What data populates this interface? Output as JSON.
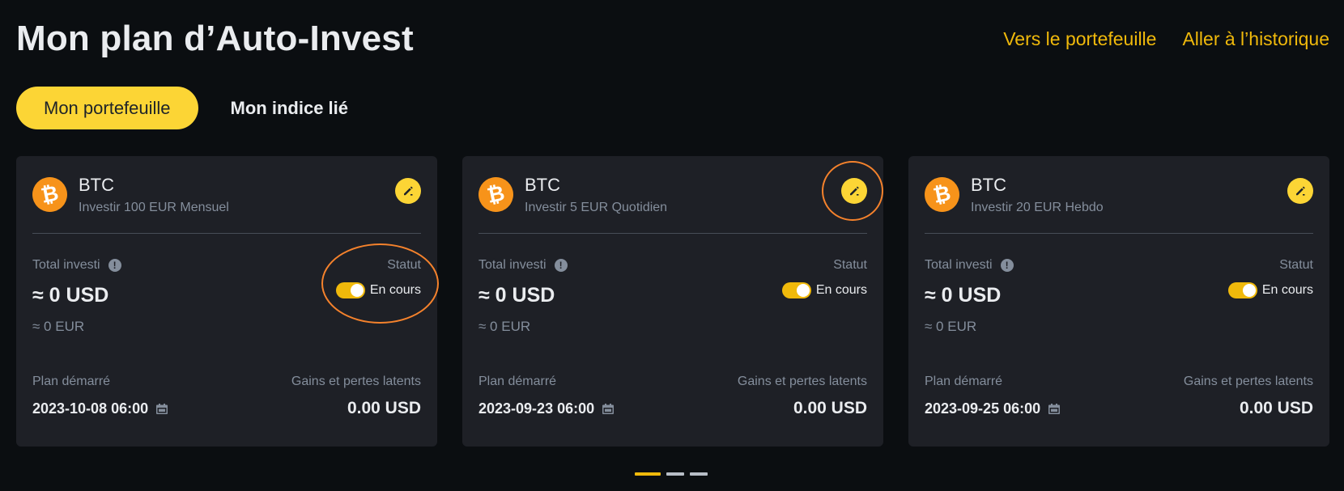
{
  "header": {
    "title": "Mon plan d’Auto-Invest",
    "links": [
      "Vers le portefeuille",
      "Aller à l’historique"
    ]
  },
  "tabs": [
    {
      "label": "Mon portefeuille",
      "active": true
    },
    {
      "label": "Mon indice lié",
      "active": false
    }
  ],
  "labels": {
    "total_invested": "Total investi",
    "status": "Statut",
    "plan_started": "Plan démarré",
    "unrealized_pnl": "Gains et pertes latents"
  },
  "cards": [
    {
      "coin": "BTC",
      "description": "Investir 100 EUR Mensuel",
      "total_usd": "≈ 0 USD",
      "total_eur": "≈ 0 EUR",
      "status": "En cours",
      "status_on": true,
      "start_date": "2023-10-08 06:00",
      "pnl": "0.00 USD"
    },
    {
      "coin": "BTC",
      "description": "Investir 5 EUR Quotidien",
      "total_usd": "≈ 0 USD",
      "total_eur": "≈ 0 EUR",
      "status": "En cours",
      "status_on": true,
      "start_date": "2023-09-23 06:00",
      "pnl": "0.00 USD"
    },
    {
      "coin": "BTC",
      "description": "Investir 20 EUR Hebdo",
      "total_usd": "≈ 0 USD",
      "total_eur": "≈ 0 EUR",
      "status": "En cours",
      "status_on": true,
      "start_date": "2023-09-25 06:00",
      "pnl": "0.00 USD"
    }
  ],
  "pager": {
    "pages": 3,
    "active": 0
  },
  "colors": {
    "accent": "#f0b90b",
    "annotation": "#f5822c",
    "coin": "#f7931a",
    "background": "#0b0e11",
    "card": "#1e2026"
  },
  "icons": {
    "coin": "bitcoin-icon",
    "edit": "edit-pen-icon",
    "info": "info-icon",
    "calendar": "calendar-icon"
  }
}
